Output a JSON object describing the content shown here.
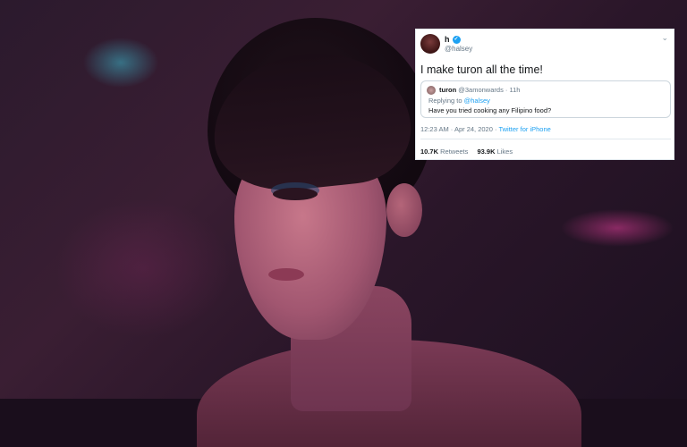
{
  "tweet": {
    "display_name": "h",
    "handle": "@halsey",
    "text": "I make turon all the time!",
    "menu_icon": "chevron-down-icon",
    "quoted": {
      "name": "turon",
      "handle": "@3amonwards",
      "separator": "·",
      "time": "11h",
      "replying_prefix": "Replying to",
      "replying_to": "@halsey",
      "text": "Have you tried cooking any Filipino food?"
    },
    "timestamp": "12:23 AM · Apr 24, 2020",
    "separator": "·",
    "source": "Twitter for iPhone",
    "retweets_count": "10.7K",
    "retweets_label": "Retweets",
    "likes_count": "93.9K",
    "likes_label": "Likes"
  },
  "colors": {
    "link": "#1da1f2",
    "secondary_text": "#657786",
    "primary_text": "#14171a"
  }
}
